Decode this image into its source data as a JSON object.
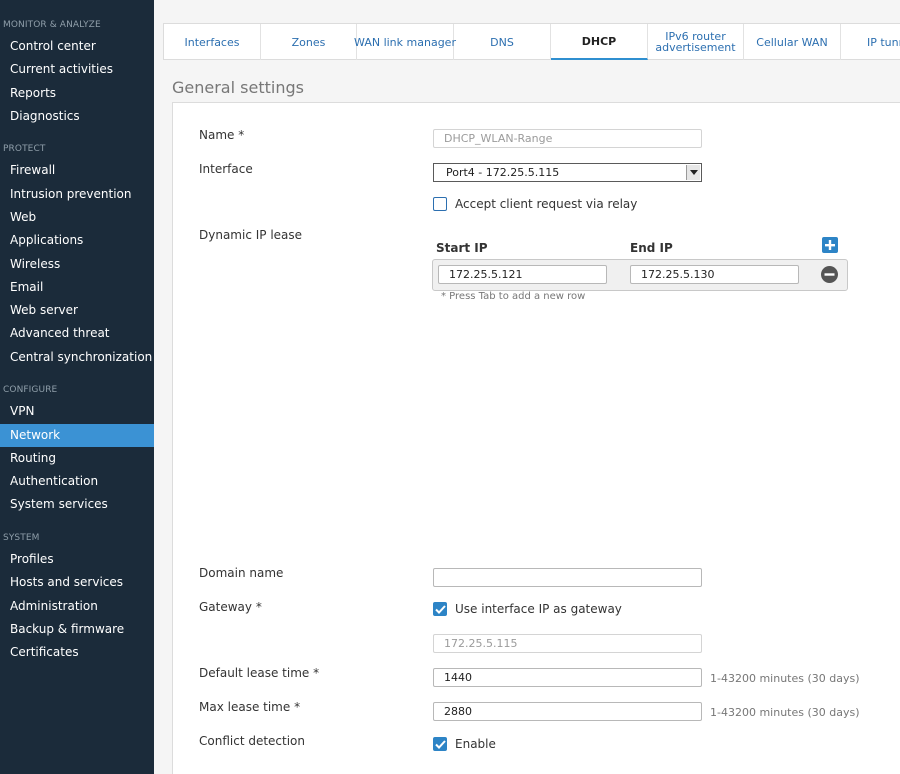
{
  "sidebar": {
    "sections": [
      {
        "title": "MONITOR & ANALYZE",
        "items": [
          "Control center",
          "Current activities",
          "Reports",
          "Diagnostics"
        ]
      },
      {
        "title": "PROTECT",
        "items": [
          "Firewall",
          "Intrusion prevention",
          "Web",
          "Applications",
          "Wireless",
          "Email",
          "Web server",
          "Advanced threat",
          "Central synchronization"
        ]
      },
      {
        "title": "CONFIGURE",
        "items": [
          "VPN",
          "Network",
          "Routing",
          "Authentication",
          "System services"
        ]
      },
      {
        "title": "SYSTEM",
        "items": [
          "Profiles",
          "Hosts and services",
          "Administration",
          "Backup & firmware",
          "Certificates"
        ]
      }
    ],
    "active_item": "Network"
  },
  "tabs": {
    "items": [
      {
        "label": "Interfaces",
        "active": false
      },
      {
        "label": "Zones",
        "active": false
      },
      {
        "label": "WAN link manager",
        "active": false
      },
      {
        "label": "DNS",
        "active": false
      },
      {
        "label": "DHCP",
        "active": true
      },
      {
        "label": "IPv6 router\nadvertisement",
        "active": false
      },
      {
        "label": "Cellular WAN",
        "active": false
      },
      {
        "label": "IP tunnels",
        "active": false
      }
    ]
  },
  "form": {
    "section_title": "General settings",
    "name": {
      "label": "Name *",
      "value": "DHCP_WLAN-Range"
    },
    "interface": {
      "label": "Interface",
      "value": "Port4 - 172.25.5.115"
    },
    "relay": {
      "label": "Accept client request via relay",
      "checked": false
    },
    "lease": {
      "label": "Dynamic IP lease",
      "start_header": "Start IP",
      "end_header": "End IP",
      "start_value": "172.25.5.121",
      "end_value": "172.25.5.130",
      "hint": "* Press Tab to add a new row"
    },
    "domain": {
      "label": "Domain name",
      "value": ""
    },
    "gateway": {
      "label": "Gateway *",
      "checkbox_label": "Use interface IP as gateway",
      "checked": true,
      "value": "172.25.5.115"
    },
    "default_lease": {
      "label": "Default lease time *",
      "value": "1440",
      "hint": "1-43200 minutes (30 days)"
    },
    "max_lease": {
      "label": "Max lease time *",
      "value": "2880",
      "hint": "1-43200 minutes (30 days)"
    },
    "conflict": {
      "label": "Conflict detection",
      "checkbox_label": "Enable",
      "checked": true
    }
  },
  "colors": {
    "sidebar_bg": "#1b2b3a",
    "active_nav": "#3b92d4",
    "link": "#2c6fb0",
    "check": "#2d84c6"
  }
}
